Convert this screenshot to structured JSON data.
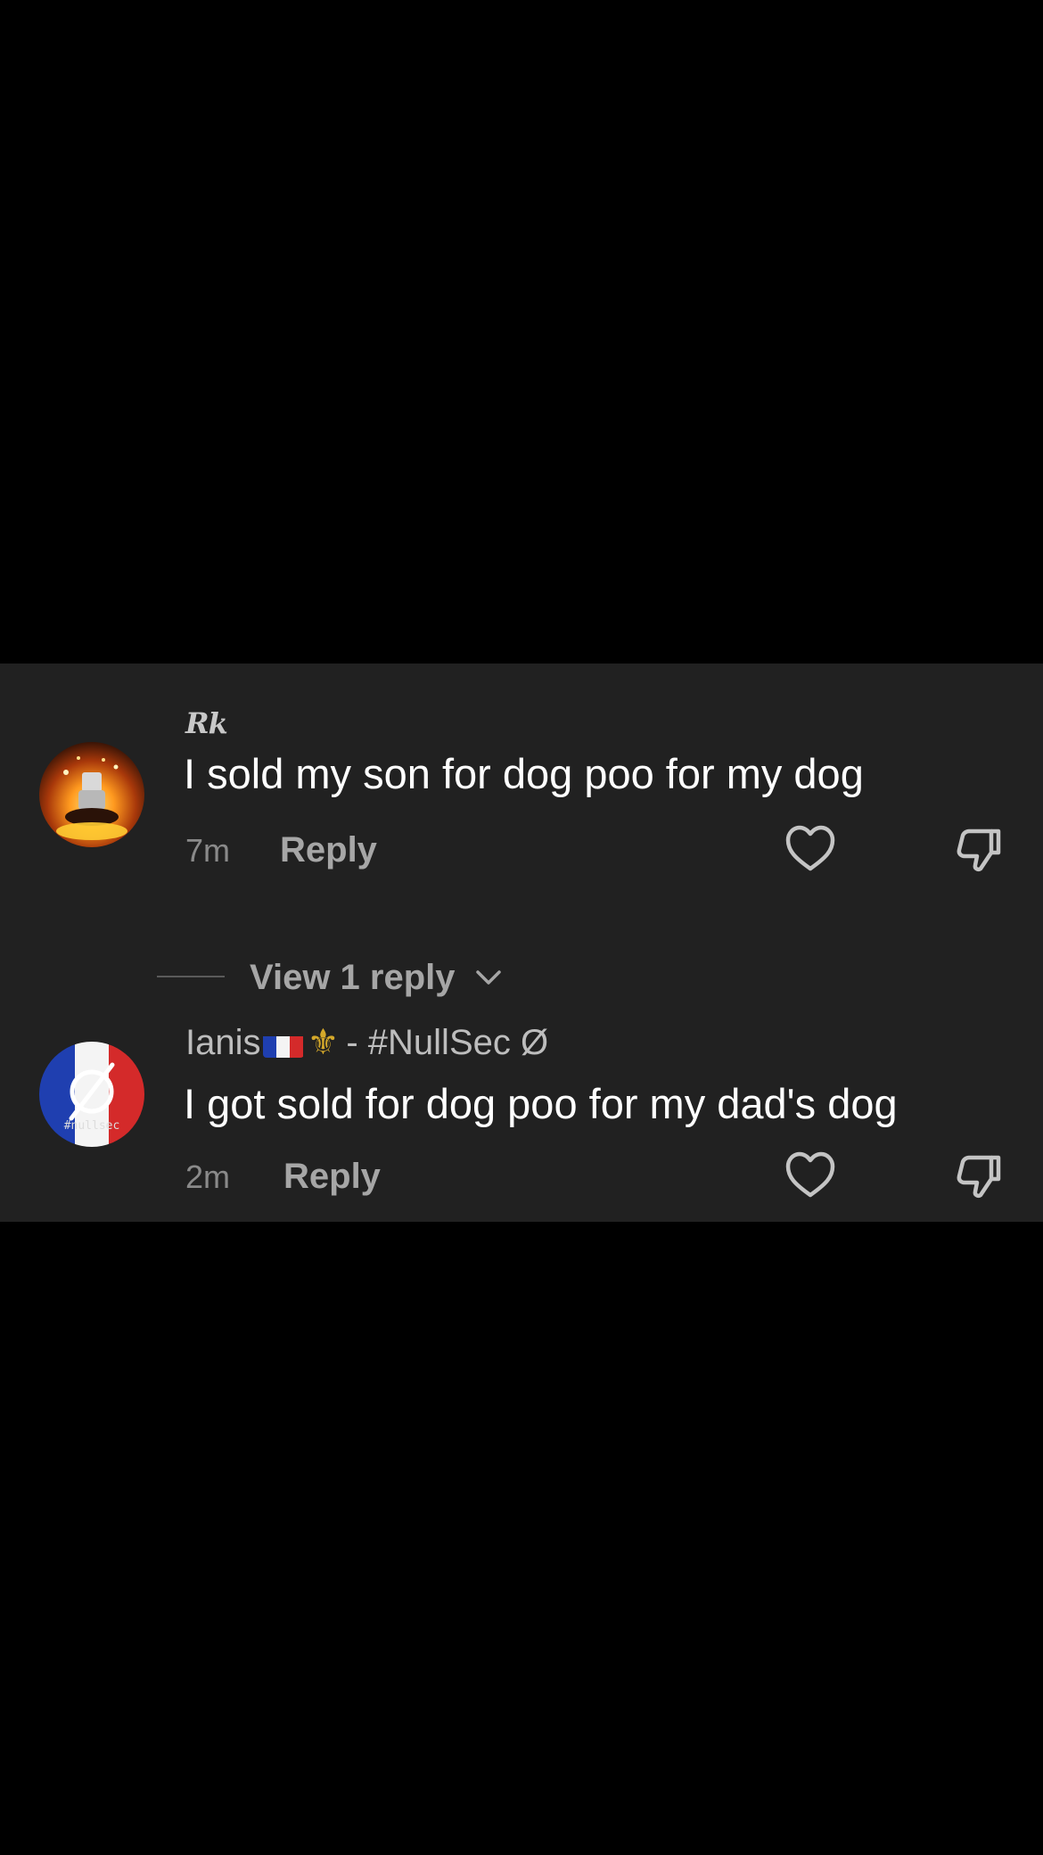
{
  "comments": [
    {
      "username": "Rk",
      "text": "I sold my son for dog poo for my dog",
      "time": "7m",
      "reply_label": "Reply",
      "avatar_icon": "fire-avatar-icon"
    },
    {
      "username_prefix": "Ianis",
      "username_suffix": "- #NullSec Ø",
      "text": "I got sold for dog poo for my dad's dog",
      "time": "2m",
      "reply_label": "Reply",
      "avatar_text": "#nullsec",
      "avatar_icon": "null-sign-avatar-icon"
    }
  ],
  "view_replies_label": "View 1 reply",
  "colors": {
    "background": "#000000",
    "panel": "#212121",
    "text_primary": "#ffffff",
    "text_secondary": "#a6a6a6",
    "flag_blue": "#1f3fb0",
    "flag_red": "#d42a2a"
  }
}
